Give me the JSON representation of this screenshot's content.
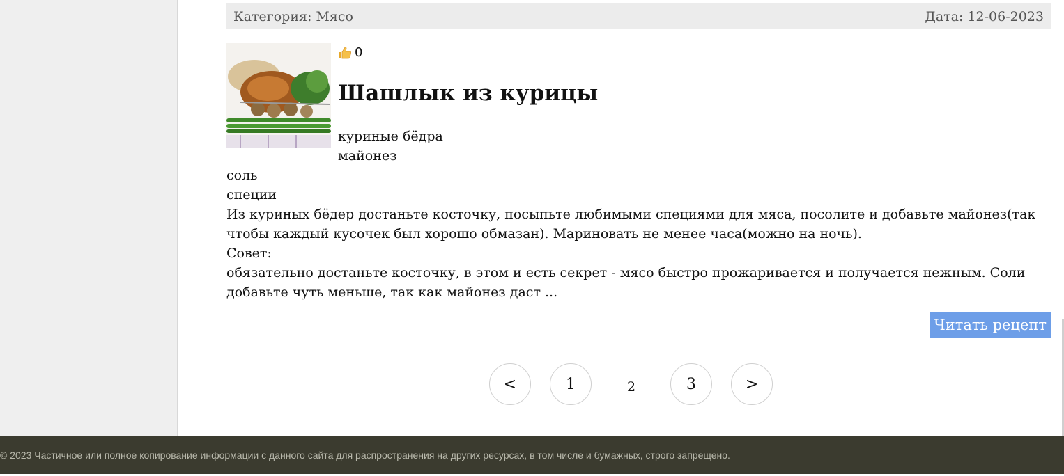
{
  "meta": {
    "category": "Категория: Мясо",
    "date": "Дата: 12-06-2023"
  },
  "recipe": {
    "likes": "0",
    "like_icon": "thumbs-up-icon",
    "title": "Шашлык из курицы",
    "ingredients": [
      "куриные бёдра",
      "майонез",
      "соль",
      "специи"
    ],
    "description": "Из куриных бёдер достаньте косточку, посыпьте любимыми специями для мяса, посолите и добавьте майонез(так чтобы каждый кусочек был хорошо обмазан). Мариновать не менее часа(можно на ночь).",
    "tip_label": "Совет:",
    "tip": "обязательно достаньте косточку, в этом и есть секрет - мясо быстро прожаривается и получается нежным. Соли добавьте чуть меньше, так как майонез даст ...",
    "read_button": "Читать рецепт"
  },
  "pagination": {
    "prev": "<",
    "page1": "1",
    "current": "2",
    "page3": "3",
    "next": ">"
  },
  "footer": {
    "text": "© 2023 Частичное или полное копирование информации с данного сайта для распространения на других ресурсах, в том числе и бумажных, строго запрещено."
  },
  "colors": {
    "button": "#6d9ee8",
    "footer_bg": "#3b3b2f"
  }
}
